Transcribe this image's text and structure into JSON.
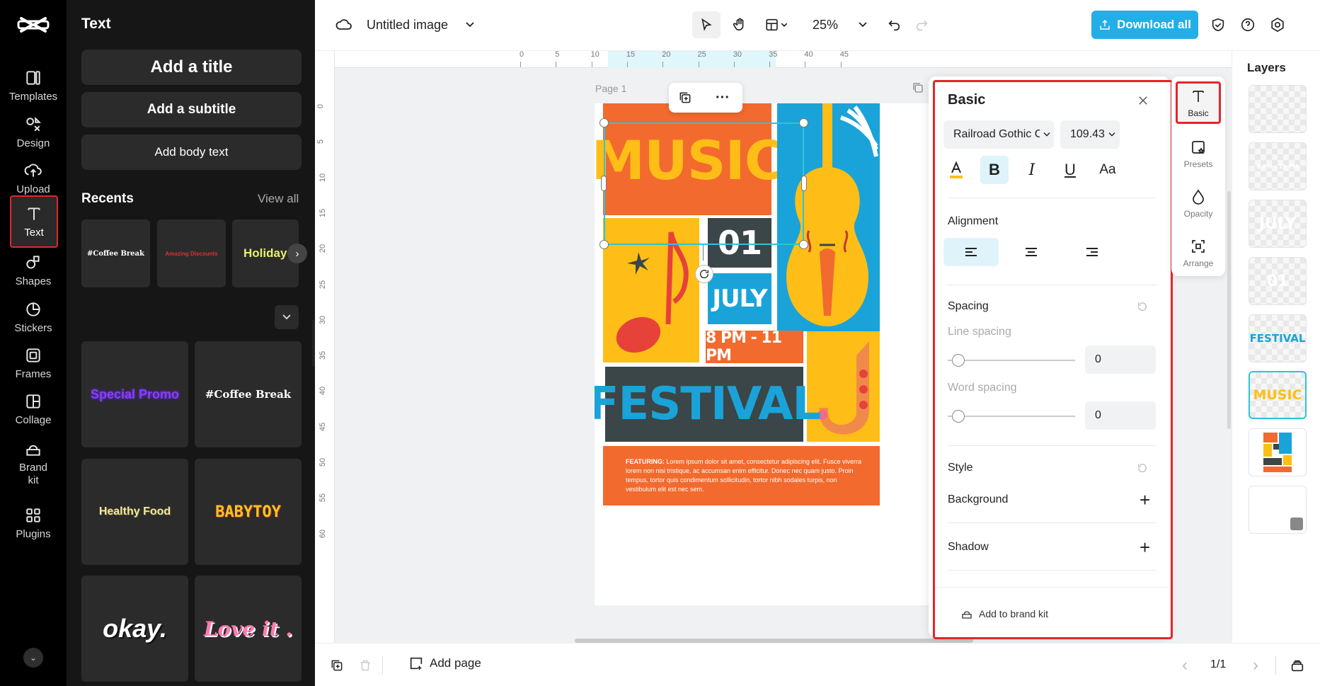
{
  "rail": {
    "items": [
      {
        "label": "Templates",
        "icon": "templates-icon"
      },
      {
        "label": "Design",
        "icon": "design-icon"
      },
      {
        "label": "Upload",
        "icon": "upload-icon"
      },
      {
        "label": "Text",
        "icon": "text-icon",
        "active": true
      },
      {
        "label": "Shapes",
        "icon": "shapes-icon"
      },
      {
        "label": "Stickers",
        "icon": "stickers-icon"
      },
      {
        "label": "Frames",
        "icon": "frames-icon"
      },
      {
        "label": "Collage",
        "icon": "collage-icon"
      },
      {
        "label": "Brand kit",
        "icon": "brand-kit-icon"
      },
      {
        "label": "Plugins",
        "icon": "plugins-icon"
      }
    ]
  },
  "text_panel": {
    "title": "Text",
    "add_title": "Add a title",
    "add_subtitle": "Add a subtitle",
    "add_body": "Add body text",
    "recents_label": "Recents",
    "view_all": "View all",
    "recents": [
      "#Coffee Break",
      "Amazing Discounts",
      "Holiday"
    ],
    "tiles": [
      "Special Promo",
      "#Coffee Break",
      "Healthy Food",
      "BABYTOY",
      "okay.",
      "Love it ."
    ]
  },
  "topbar": {
    "doc_title": "Untitled image",
    "zoom": "25%",
    "download_label": "Download all"
  },
  "ruler": {
    "h_ticks": [
      "0",
      "5",
      "10",
      "15",
      "20",
      "25",
      "30",
      "35",
      "40",
      "45"
    ],
    "v_ticks": [
      "0",
      "5",
      "10",
      "15",
      "20",
      "25",
      "30",
      "35",
      "40",
      "45",
      "50",
      "55",
      "60"
    ]
  },
  "canvas": {
    "page_label": "Page 1",
    "poster": {
      "music": "MUSIC",
      "day": "01",
      "month": "JULY",
      "time": "8 PM - 11 PM",
      "festival": "FESTIVAL",
      "featuring_label": "FEATURING:",
      "featuring_body": "Lorem ipsum dolor sit amet, consectetur adipiscing elit. Fusce viverra lorem non nisi tristique, ac accumsan enim efficitur. Donec nec quam justo. Proin tempus, tortor quis condimentum sollicitudin, tortor nibh sodales turpis, non vestibulum elit est nec sem."
    }
  },
  "bottombar": {
    "add_page": "Add page",
    "page_counter": "1/1"
  },
  "props": {
    "title": "Basic",
    "font": "Railroad Gothic C",
    "size": "109.43",
    "alignment_label": "Alignment",
    "spacing_label": "Spacing",
    "line_spacing_label": "Line spacing",
    "line_spacing_value": "0",
    "word_spacing_label": "Word spacing",
    "word_spacing_value": "0",
    "style_label": "Style",
    "background_label": "Background",
    "shadow_label": "Shadow",
    "add_brand": "Add to brand kit"
  },
  "tools": [
    {
      "label": "Basic",
      "icon": "text-icon",
      "active": true
    },
    {
      "label": "Presets",
      "icon": "presets-icon"
    },
    {
      "label": "Opacity",
      "icon": "opacity-icon"
    },
    {
      "label": "Arrange",
      "icon": "arrange-icon"
    }
  ],
  "layers": {
    "title": "Layers",
    "items": [
      "8 PM - 11 PM",
      "JULY",
      "01",
      "FESTIVAL",
      "MUSIC"
    ]
  },
  "colors": {
    "accent": "#23aee8",
    "highlight": "#e5252a",
    "poster_orange": "#f26a2e",
    "poster_yellow": "#ffbe17",
    "poster_blue": "#1aa3d8",
    "poster_dark": "#3a4648"
  }
}
